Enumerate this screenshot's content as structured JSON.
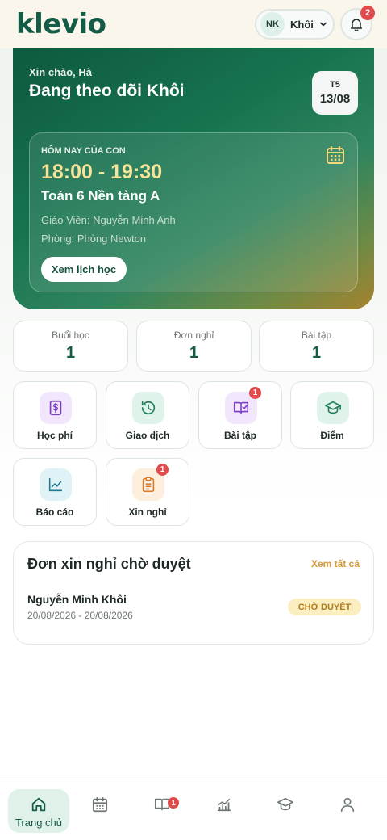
{
  "app": {
    "logo": "klevio"
  },
  "header": {
    "child_initials": "NK",
    "child_name": "Khôi",
    "notification_count": "2"
  },
  "hero": {
    "greeting": "Xin chào, Hà",
    "tracking": "Đang theo dõi Khôi",
    "date_dow": "T5",
    "date_day": "13/08",
    "today_label": "HÔM NAY CỦA CON",
    "time": "18:00 - 19:30",
    "class_name": "Toán 6 Nền tảng A",
    "teacher": "Giáo Viên: Nguyễn Minh Anh",
    "room": "Phòng: Phòng Newton",
    "schedule_button": "Xem lịch học"
  },
  "stats": [
    {
      "label": "Buổi học",
      "value": "1"
    },
    {
      "label": "Đơn nghỉ",
      "value": "1"
    },
    {
      "label": "Bài tập",
      "value": "1"
    }
  ],
  "actions": [
    {
      "label": "Học phí",
      "icon": "dollar-bill-icon",
      "color": "#7b3fc4",
      "bg": "#f1e6fb",
      "badge": ""
    },
    {
      "label": "Giao dịch",
      "icon": "history-icon",
      "color": "#1f7a5a",
      "bg": "#dff3ea",
      "badge": ""
    },
    {
      "label": "Bài tập",
      "icon": "book-check-icon",
      "color": "#7b3fc4",
      "bg": "#f1e6fb",
      "badge": "1"
    },
    {
      "label": "Điểm",
      "icon": "graduation-cap-icon",
      "color": "#1f7a5a",
      "bg": "#dff3ea",
      "badge": ""
    },
    {
      "label": "Báo cáo",
      "icon": "chart-line-icon",
      "color": "#1f7a90",
      "bg": "#dff2f6",
      "badge": ""
    },
    {
      "label": "Xin nghỉ",
      "icon": "clipboard-icon",
      "color": "#d97a2b",
      "bg": "#fdeedd",
      "badge": "1"
    }
  ],
  "leave": {
    "title": "Đơn xin nghỉ chờ duyệt",
    "see_all": "Xem tất cả",
    "name": "Nguyễn Minh Khôi",
    "dates": "20/08/2026 - 20/08/2026",
    "status": "CHỜ DUYỆT"
  },
  "nav": {
    "home_label": "Trang chủ",
    "homework_badge": "1",
    "items": [
      "home-icon",
      "calendar-icon",
      "book-open-icon",
      "bar-chart-icon",
      "graduation-cap-icon",
      "user-icon"
    ]
  },
  "colors": {
    "brand": "#145c48",
    "accent_gold": "#d49a3a",
    "badge_red": "#e14b4b"
  }
}
